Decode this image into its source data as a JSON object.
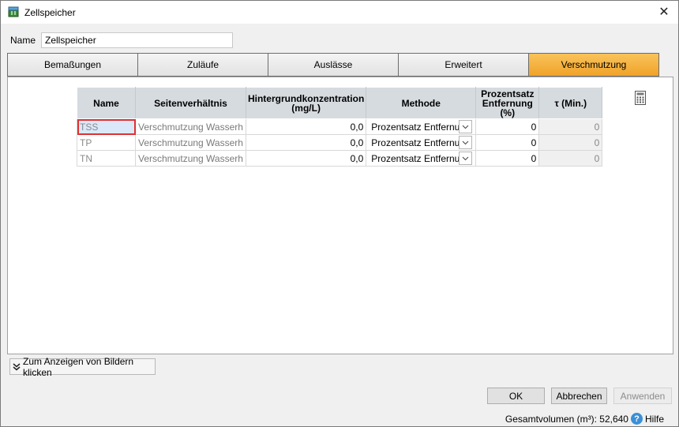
{
  "window": {
    "title": "Zellspeicher",
    "close_glyph": "✕"
  },
  "name_field": {
    "label": "Name",
    "value": "Zellspeicher"
  },
  "tabs": [
    {
      "label": "Bemaßungen",
      "active": false
    },
    {
      "label": "Zuläufe",
      "active": false
    },
    {
      "label": "Auslässe",
      "active": false
    },
    {
      "label": "Erweitert",
      "active": false
    },
    {
      "label": "Verschmutzung",
      "active": true
    }
  ],
  "table": {
    "headers": {
      "name": "Name",
      "ratio": "Seitenverhältnis",
      "background": "Hintergrundkonzentration (mg/L)",
      "method": "Methode",
      "percent": "Prozentsatz Entfernung (%)",
      "tau": "τ (Min.)"
    },
    "rows": [
      {
        "name": "TSS",
        "ratio": "Verschmutzung Wasserh",
        "background": "0,0",
        "method": "Prozentsatz Entfernung",
        "percent": "0",
        "tau": "0"
      },
      {
        "name": "TP",
        "ratio": "Verschmutzung Wasserh",
        "background": "0,0",
        "method": "Prozentsatz Entfernung",
        "percent": "0",
        "tau": "0"
      },
      {
        "name": "TN",
        "ratio": "Verschmutzung Wasserh",
        "background": "0,0",
        "method": "Prozentsatz Entfernung",
        "percent": "0",
        "tau": "0"
      }
    ]
  },
  "images_button": {
    "label": "Zum Anzeigen von Bildern klicken",
    "icon": "double-chevron-down-icon"
  },
  "buttons": {
    "ok": "OK",
    "cancel": "Abbrechen",
    "apply": "Anwenden"
  },
  "status": {
    "volume_text": "Gesamtvolumen (m³): 52,640",
    "help": "Hilfe"
  },
  "colors": {
    "active_tab": "#f0a22a",
    "header_bg": "#d6dbe0",
    "selection_outline": "#e03030",
    "help_icon": "#3c8fd6"
  }
}
